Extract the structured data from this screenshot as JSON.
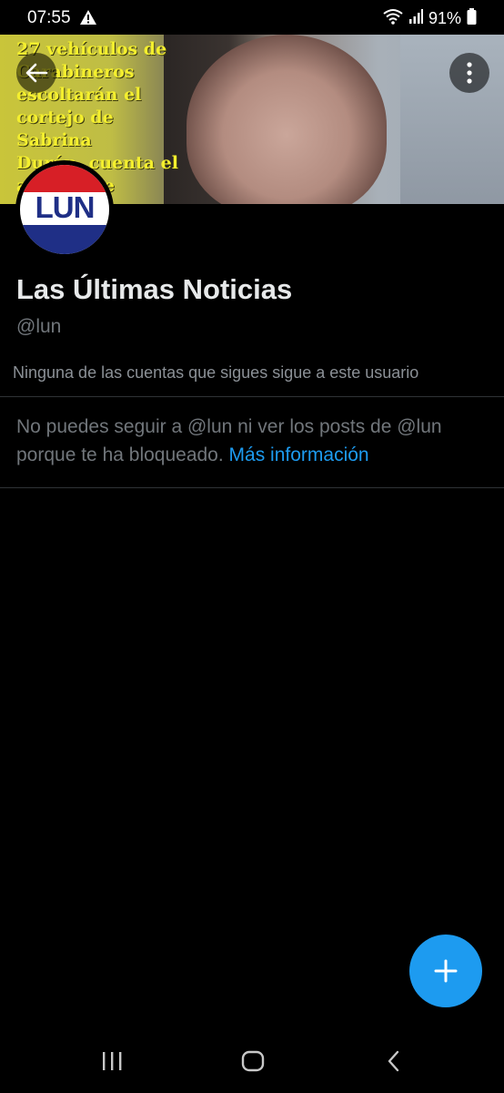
{
  "status_bar": {
    "time": "07:55",
    "battery": "91%",
    "icons": [
      "warning-icon",
      "wifi-icon",
      "signal-icon",
      "battery-icon"
    ]
  },
  "banner": {
    "headline_lines": [
      "27 vehículos de",
      "Carabineros",
      "escoltarán el",
      "cortejo de Sabrina",
      "Durán, cuenta el",
      "alcalde de Peñaflor"
    ],
    "headline_color": "#f4ef2e"
  },
  "profile": {
    "avatar_text": "LUN",
    "name": "Las Últimas Noticias",
    "handle": "@lun",
    "follow_note": "Ninguna de las cuentas que sigues sigue a este usuario"
  },
  "blocked_notice": {
    "text": "No puedes seguir a @lun ni ver los posts de @lun porque te ha bloqueado. ",
    "link": "Más información"
  },
  "colors": {
    "background": "#000000",
    "accent": "#1d9bf0",
    "muted_text": "#71767b",
    "divider": "#2f3336"
  },
  "icons": {
    "back": "arrow-left-icon",
    "more": "more-vertical-icon",
    "compose": "plus-icon",
    "recents": "recents-icon",
    "home": "home-icon",
    "nav_back": "chevron-left-icon"
  }
}
